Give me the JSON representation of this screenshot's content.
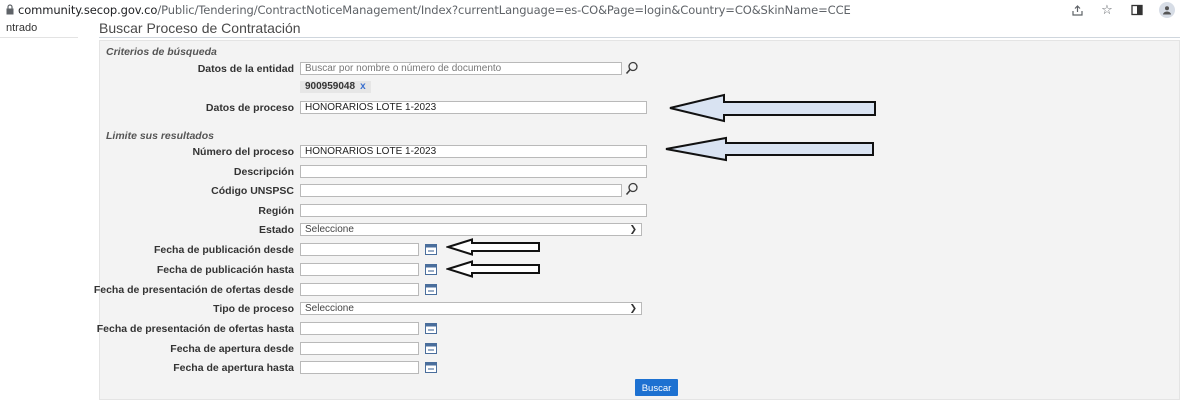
{
  "browser": {
    "url_host": "community.secop.gov.co",
    "url_path": "/Public/Tendering/ContractNoticeManagement/Index?currentLanguage=es-CO&Page=login&Country=CO&SkinName=CCE",
    "icons": [
      "lock-icon",
      "share-icon",
      "star-icon",
      "sidebar-icon",
      "profile-icon"
    ]
  },
  "left": {
    "label": "ntrado"
  },
  "page": {
    "title": "Buscar Proceso de Contratación"
  },
  "sections": {
    "criteria": "Criterios de búsqueda",
    "limit": "Limite sus resultados"
  },
  "fields": {
    "entidad": {
      "label": "Datos de la entidad",
      "placeholder": "Buscar por nombre o número de documento",
      "chip": "900959048",
      "chip_remove": "x"
    },
    "proceso": {
      "label": "Datos de proceso",
      "value": "HONORARIOS LOTE 1-2023"
    },
    "numero": {
      "label": "Número del proceso",
      "value": "HONORARIOS LOTE 1-2023"
    },
    "descripcion": {
      "label": "Descripción",
      "value": ""
    },
    "unspsc": {
      "label": "Código UNSPSC",
      "value": ""
    },
    "region": {
      "label": "Región",
      "value": ""
    },
    "estado": {
      "label": "Estado",
      "value": "Seleccione"
    },
    "pub_desde": {
      "label": "Fecha de publicación desde",
      "value": ""
    },
    "pub_hasta": {
      "label": "Fecha de publicación hasta",
      "value": ""
    },
    "ofertas_desde": {
      "label": "Fecha de presentación de ofertas desde",
      "value": ""
    },
    "tipo": {
      "label": "Tipo de proceso",
      "value": "Seleccione"
    },
    "ofertas_hasta": {
      "label": "Fecha de presentación de ofertas hasta",
      "value": ""
    },
    "apertura_desde": {
      "label": "Fecha de apertura desde",
      "value": ""
    },
    "apertura_hasta": {
      "label": "Fecha de apertura hasta",
      "value": ""
    }
  },
  "buttons": {
    "search": "Buscar"
  },
  "colors": {
    "button": "#1d71d1",
    "panel": "#f3f3f3",
    "arrow_fill": "#d9e3f2"
  }
}
